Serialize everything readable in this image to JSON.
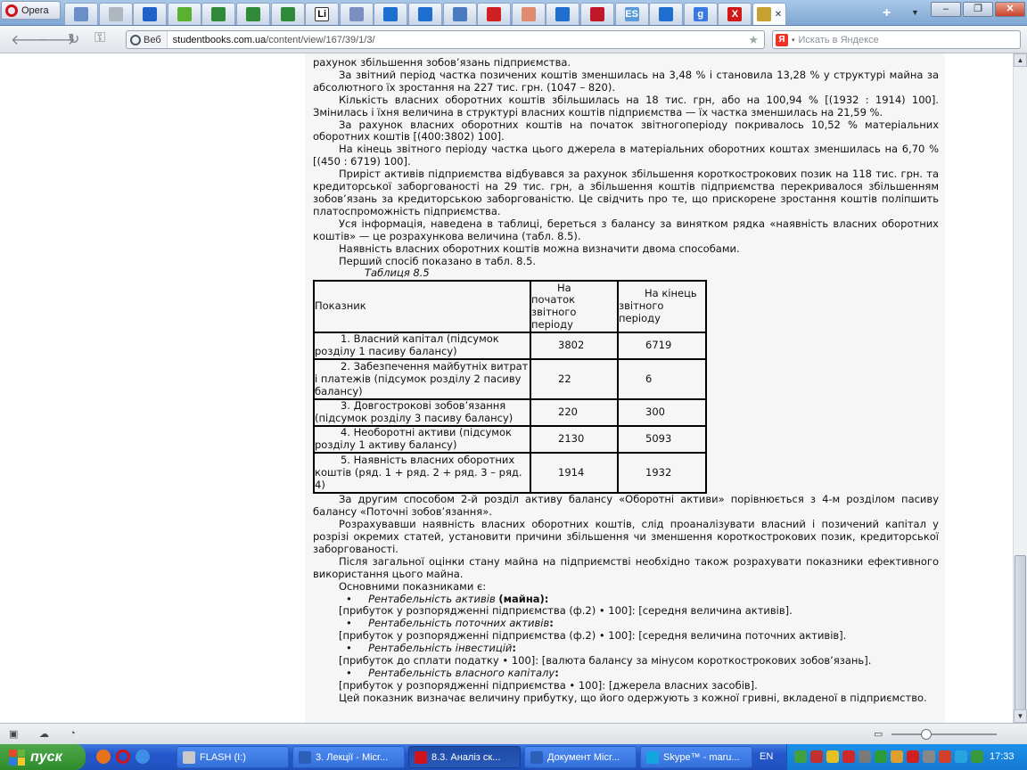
{
  "browser": {
    "menu_label": "Opera",
    "address_prefix": "Веб",
    "url_host": "studentbooks.com.ua",
    "url_path": "/content/view/167/39/1/3/",
    "search_placeholder": "Искать в Яндексе",
    "search_engine_icon_label": "Я"
  },
  "tabs": [
    {
      "icon": "page-icon",
      "color": "#6a8fc8"
    },
    {
      "icon": "page-icon",
      "color": "#b0b6c0"
    },
    {
      "icon": "info-icon",
      "color": "#1e62c8"
    },
    {
      "icon": "apple-icon",
      "color": "#5cb030"
    },
    {
      "icon": "tools-icon",
      "color": "#2f8a3a"
    },
    {
      "icon": "tools-icon",
      "color": "#2f8a3a"
    },
    {
      "icon": "tools-icon",
      "color": "#2f8a3a"
    },
    {
      "icon": "li-icon",
      "color": "#222222",
      "label": "Li"
    },
    {
      "icon": "page-icon",
      "color": "#7d8fc0"
    },
    {
      "icon": "up-arrow-icon",
      "color": "#1e6fd0"
    },
    {
      "icon": "up-arrow-icon",
      "color": "#1e6fd0"
    },
    {
      "icon": "document-icon",
      "color": "#4a7ac0"
    },
    {
      "icon": "red-logo-icon",
      "color": "#d02020"
    },
    {
      "icon": "chart-icon",
      "color": "#e08a70"
    },
    {
      "icon": "up-arrow-icon",
      "color": "#1e6fd0"
    },
    {
      "icon": "red-logo-icon",
      "color": "#c0182a"
    },
    {
      "icon": "es-icon",
      "color": "#5a9ad8",
      "label": "ES"
    },
    {
      "icon": "up-arrow-icon",
      "color": "#1e6fd0"
    },
    {
      "icon": "google-icon",
      "color": "#3a7ae0",
      "label": "g"
    },
    {
      "icon": "x-icon",
      "color": "#d01818",
      "label": "X"
    },
    {
      "icon": "graduation-cap-icon",
      "color": "#c8a030",
      "active": true
    }
  ],
  "article": {
    "p_top": "рахунок збільшення зобов’язань підприємства.",
    "p1": "За звітний період частка позичених коштів зменшилась на 3,48 % і становила 13,28 % у структурі майна за абсолютного їх зростання на 227 тис. грн. (1047 – 820).",
    "p2": "Кількість власних оборотних коштів збільшилась на 18 тис. грн, або на 100,94 % [(1932 : 1914) 100]. Змінилась і їхня величина в структурі власних коштів підприємства — їх частка зменшилась на 21,59 %.",
    "p3": "За рахунок власних оборотних коштів на початок звітногоперіоду покривалось 10,52 % матеріальних оборотних коштів [(400:3802) 100].",
    "p4": "На кінець звітного періоду частка цього джерела в матеріальних оборотних коштах зменшилась на 6,70 % [(450 : 6719) 100].",
    "p5": "Приріст активів підприємства відбувався за рахунок збільшення короткострокових позик на 118 тис. грн. та кредиторської заборгованості на 29 тис. грн, а збільшення коштів підприємства перекривалося збільшенням зобов’язань за кредиторською заборгованістю. Це свідчить про те, що прискорене зростання коштів поліпшить платоспроможність підприємства.",
    "p6": "Уся інформація, наведена в таблиці, береться з балансу за винятком рядка «наявність власних оборотних коштів» — це розрахункова величина (табл. 8.5).",
    "p7": "Наявність власних оборотних коштів можна визначити двома способами.",
    "p8": "Перший спосіб показано в табл. 8.5.",
    "table_caption": "Таблиця 8.5",
    "p9": "За другим способом 2-й розділ активу балансу «Оборотні активи» порівнюється з 4-м розділом пасиву балансу «Поточні зобов’язання».",
    "p10": "Розрахувавши наявність власних оборотних коштів, слід проаналізувати власний і позичений капітал у розрізі окремих статей, установити причини збільшення чи зменшення короткострокових позик, кредиторської заборгованості.",
    "p11": "Після загальної оцінки стану майна на підприємстві необхідно також розрахувати показники ефективного використання цього майна.",
    "p12": "Основними показниками є:",
    "b1_label": "Рентабельність активів",
    "b1_suffix": "(майна):",
    "f1": "[прибуток у розпорядженні підприємства (ф.2) • 100]: [середня величина активів].",
    "b2_label": "Рентабельність поточних активів",
    "b2_suffix": ":",
    "f2": "[прибуток у розпорядженні підприємства (ф.2) • 100]: [середня величина поточних активів].",
    "b3_label": "Рентабельність інвестицій",
    "b3_suffix": ":",
    "f3": "[прибуток до сплати податку • 100]: [валюта балансу за мінусом короткострокових зобов’язань].",
    "b4_label": "Рентабельність власного капіталу",
    "b4_suffix": ":",
    "f4": "[прибуток у розпорядженні підприємства • 100]: [джерела власних засобів].",
    "p13": "Цей показник визначає величину прибутку, що його одержують з кожної гривні, вкладеної в підприємство."
  },
  "table": {
    "header": {
      "c1": "Показник",
      "c2": "На початок звітного періоду",
      "c3": "На кінець звітного періоду"
    },
    "rows": [
      {
        "label": "1. Власний капітал (підсумок розділу 1 пасиву балансу)",
        "start": "3802",
        "end": "6719"
      },
      {
        "label": "2. Забезпечення майбутніх витрат і платежів (підсумок розділу 2 пасиву балансу)",
        "start": "22",
        "end": "6"
      },
      {
        "label": "3. Довгострокові зобов’язання (підсумок розділу 3 пасиву балансу)",
        "start": "220",
        "end": "300"
      },
      {
        "label": "4. Необоротні активи (підсумок розділу 1 активу балансу)",
        "start": "2130",
        "end": "5093"
      },
      {
        "label": "5. Наявність власних оборотних коштів (ряд. 1 + ряд. 2 + ряд. 3 – ряд. 4)",
        "start": "1914",
        "end": "1932"
      }
    ]
  },
  "taskbar": {
    "start_label": "пуск",
    "tasks": [
      {
        "label": "FLASH (I:)",
        "icon": "drive-icon",
        "color": "#c9c9c9"
      },
      {
        "label": "3. Лекції - Micr...",
        "icon": "word-icon",
        "color": "#2b5fb8"
      },
      {
        "label": "8.3. Аналіз ск...",
        "icon": "opera-icon",
        "color": "#d0121b",
        "active": true
      },
      {
        "label": "Документ Micr...",
        "icon": "word-icon",
        "color": "#2b5fb8"
      },
      {
        "label": "Skype™ - maru...",
        "icon": "skype-icon",
        "color": "#12a5e0"
      }
    ],
    "language": "EN",
    "clock": "17:33"
  }
}
